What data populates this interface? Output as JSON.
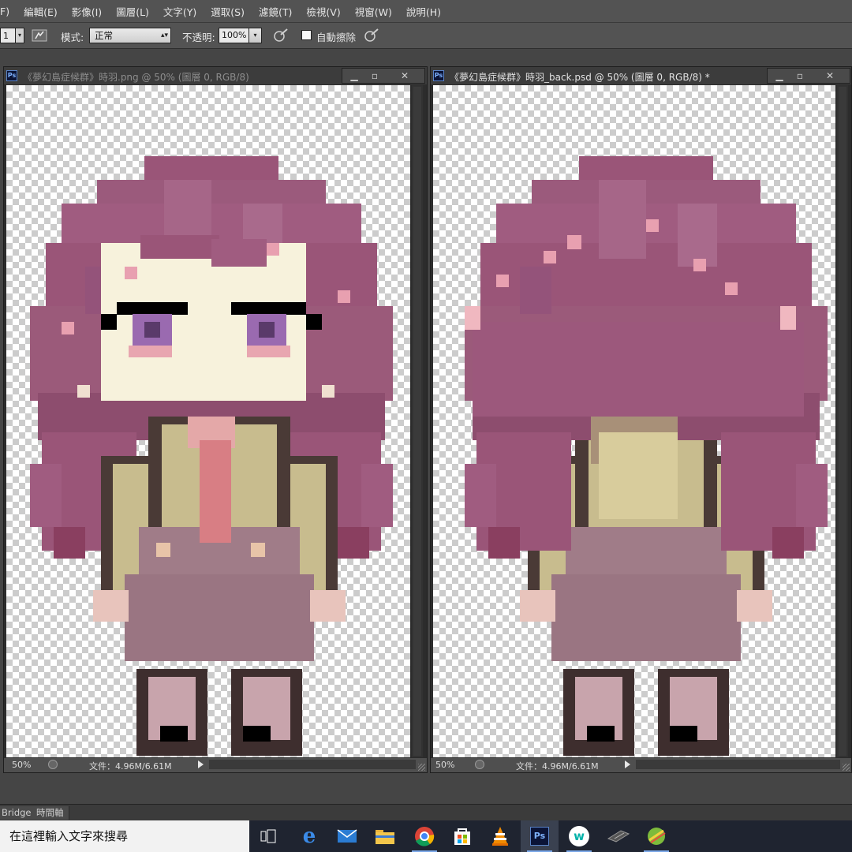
{
  "menu": {
    "items": [
      "F)",
      "編輯(E)",
      "影像(I)",
      "圖層(L)",
      "文字(Y)",
      "選取(S)",
      "濾鏡(T)",
      "檢視(V)",
      "視窗(W)",
      "說明(H)"
    ]
  },
  "options": {
    "brush_size": "1",
    "mode_label": "模式:",
    "mode_value": "正常",
    "opacity_label": "不透明:",
    "opacity_value": "100%",
    "auto_erase_label": "自動擦除"
  },
  "windows": [
    {
      "title": "《夢幻島症候群》時羽.png @ 50% (圖層 0, RGB/8)",
      "zoom": "50%",
      "file_info": "文件：4.96M/6.61M",
      "active": false
    },
    {
      "title": "《夢幻島症候群》時羽_back.psd @ 50% (圖層 0, RGB/8) *",
      "zoom": "50%",
      "file_info": "文件：4.96M/6.61M",
      "active": true
    }
  ],
  "panel_tabs": [
    "Bridge",
    "時間軸"
  ],
  "taskbar": {
    "search_placeholder": "在這裡輸入文字來搜尋",
    "apps": [
      "task-view",
      "edge",
      "mail",
      "file-explorer",
      "chrome",
      "store",
      "vlc",
      "photoshop",
      "webtoon",
      "pen-tablet",
      "paint-tool"
    ]
  },
  "colors": {
    "hair": "#9a5578",
    "hair_highlight": "#e8a0b0",
    "skin": "#f7f2dc",
    "eye": "#9a6ab0",
    "jacket": "#c8bc8e",
    "outline": "#4a3a36",
    "skirt": "#a07c88",
    "ps_blue": "#0b1437"
  }
}
